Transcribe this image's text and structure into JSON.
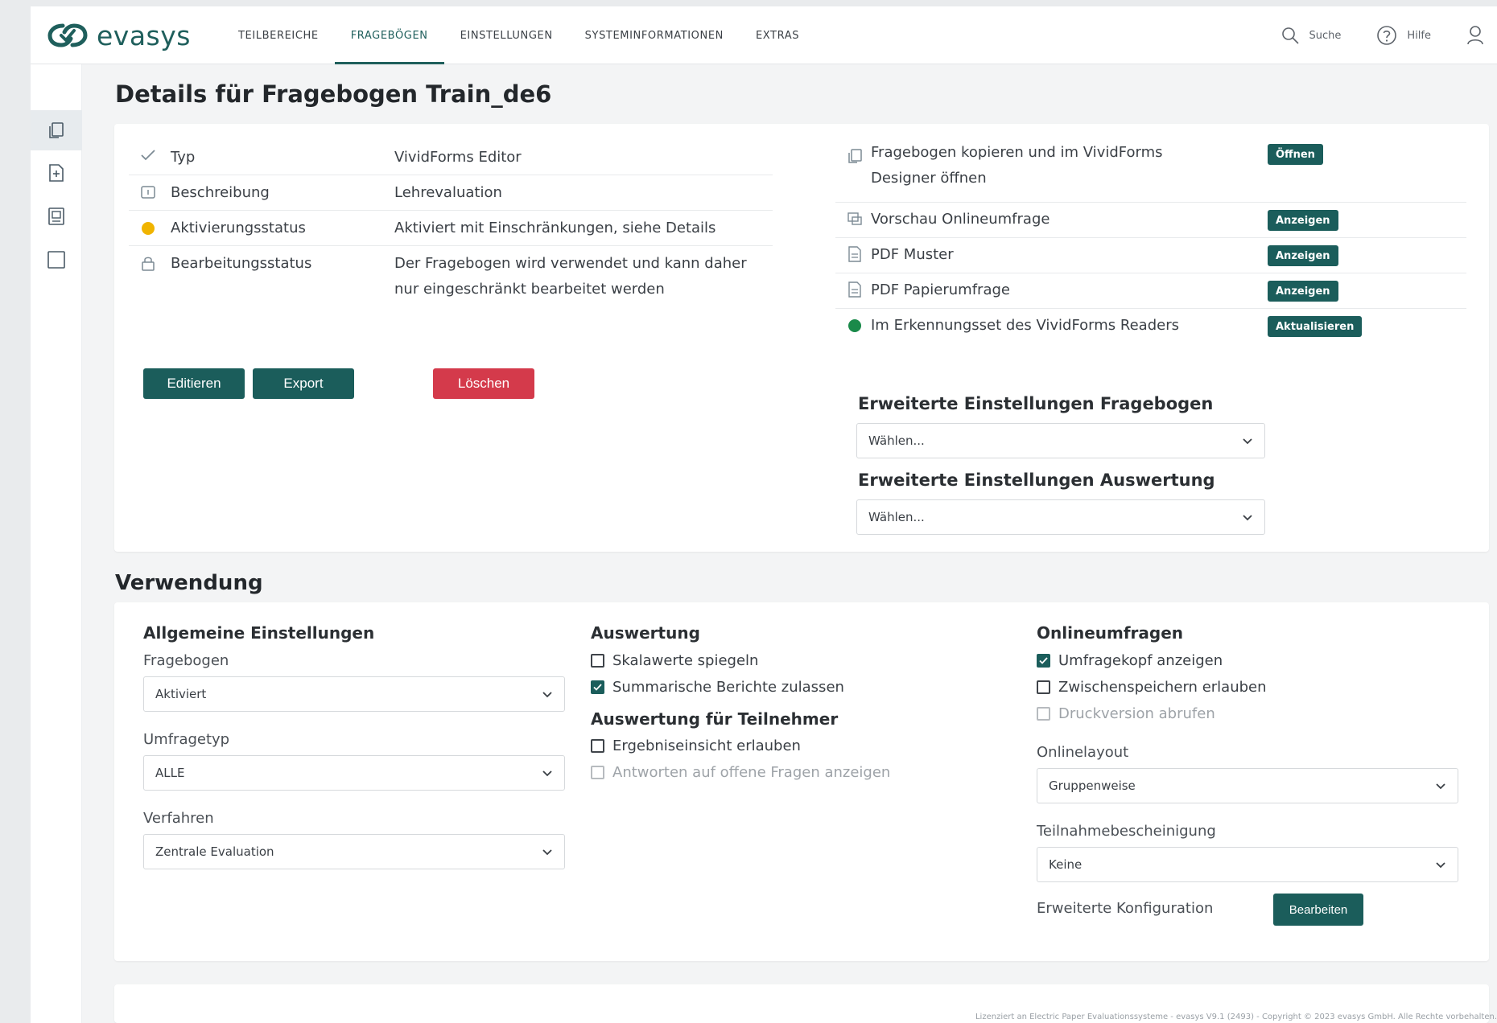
{
  "brand": {
    "name": "evasys",
    "accent": "#1b5d5b",
    "danger": "#d43a4b"
  },
  "nav": {
    "items": [
      {
        "label": "Teilbereiche",
        "active": false
      },
      {
        "label": "Fragebögen",
        "active": true
      },
      {
        "label": "Einstellungen",
        "active": false
      },
      {
        "label": "Systeminformationen",
        "active": false
      },
      {
        "label": "Extras",
        "active": false
      }
    ]
  },
  "tools": {
    "search_label": "Suche",
    "help_label": "Hilfe"
  },
  "page": {
    "title": "Details für Fragebogen Train_de6"
  },
  "details": {
    "rows": [
      {
        "icon": "check-icon",
        "label": "Typ",
        "value": "VividForms Editor"
      },
      {
        "icon": "description-icon",
        "label": "Beschreibung",
        "value": "Lehrevaluation"
      },
      {
        "icon": "status-dot-icon",
        "label": "Aktivierungsstatus",
        "value": "Aktiviert mit Einschränkungen, siehe Details",
        "color": "#f0b400"
      },
      {
        "icon": "lock-icon",
        "label": "Bearbeitungsstatus",
        "value": "Der Fragebogen wird verwendet und kann daher nur eingeschränkt bearbeitet werden"
      }
    ],
    "buttons": {
      "edit": "Editieren",
      "export": "Export",
      "delete": "Löschen"
    }
  },
  "actions": {
    "rows": [
      {
        "icon": "copy-icon",
        "label": "Fragebogen kopieren und im VividForms Designer öffnen",
        "badge": "Öffnen"
      },
      {
        "icon": "preview-icon",
        "label": "Vorschau Onlineumfrage",
        "badge": "Anzeigen"
      },
      {
        "icon": "pdf-icon",
        "label": "PDF Muster",
        "badge": "Anzeigen"
      },
      {
        "icon": "pdf-icon",
        "label": "PDF Papierumfrage",
        "badge": "Anzeigen"
      },
      {
        "icon": "status-dot-icon",
        "label": "Im Erkennungsset des VividForms Readers",
        "badge": "Aktualisieren",
        "color": "#1a8a4a"
      }
    ]
  },
  "advanced": {
    "questionnaire_label": "Erweiterte Einstellungen Fragebogen",
    "questionnaire_value": "Wählen...",
    "evaluation_label": "Erweiterte Einstellungen Auswertung",
    "evaluation_value": "Wählen..."
  },
  "usage": {
    "title": "Verwendung",
    "general": {
      "title": "Allgemeine Einstellungen",
      "questionnaire_label": "Fragebogen",
      "questionnaire_value": "Aktiviert",
      "survey_type_label": "Umfragetyp",
      "survey_type_value": "ALLE",
      "procedure_label": "Verfahren",
      "procedure_value": "Zentrale Evaluation"
    },
    "evaluation": {
      "title": "Auswertung",
      "checks": [
        {
          "label": "Skalawerte spiegeln",
          "checked": false,
          "disabled": false
        },
        {
          "label": "Summarische Berichte zulassen",
          "checked": true,
          "disabled": false
        }
      ],
      "participants_title": "Auswertung für Teilnehmer",
      "participant_checks": [
        {
          "label": "Ergebniseinsicht erlauben",
          "checked": false,
          "disabled": false
        },
        {
          "label": "Antworten auf offene Fragen anzeigen",
          "checked": false,
          "disabled": true
        }
      ]
    },
    "online": {
      "title": "Onlineumfragen",
      "checks": [
        {
          "label": "Umfragekopf anzeigen",
          "checked": true,
          "disabled": false
        },
        {
          "label": "Zwischenspeichern erlauben",
          "checked": false,
          "disabled": false
        },
        {
          "label": "Druckversion abrufen",
          "checked": false,
          "disabled": true
        }
      ],
      "layout_label": "Onlinelayout",
      "layout_value": "Gruppenweise",
      "certificate_label": "Teilnahmebescheinigung",
      "certificate_value": "Keine",
      "config_label": "Erweiterte Konfiguration",
      "config_button": "Bearbeiten"
    }
  },
  "footer": "Lizenziert an Electric Paper Evaluationssysteme - evasys V9.1 (2493) - Copyright © 2023 evasys GmbH. Alle Rechte vorbehalten."
}
